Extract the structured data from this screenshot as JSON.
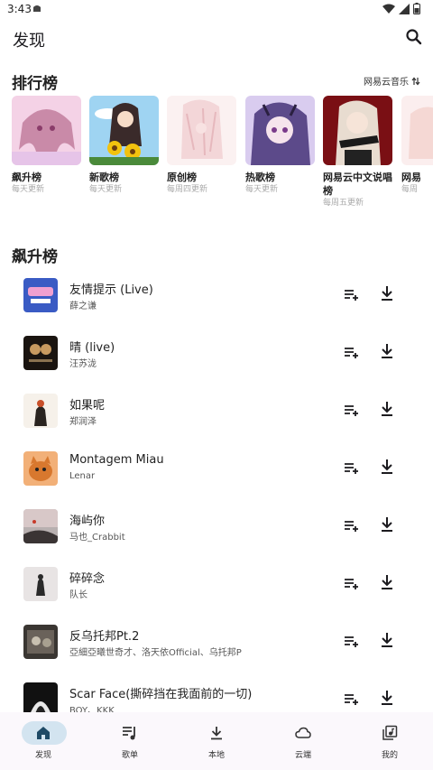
{
  "status": {
    "time": "3:43"
  },
  "appbar": {
    "title": "发现"
  },
  "charts_section": {
    "title": "排行榜",
    "source": "网易云音乐"
  },
  "ranks": [
    {
      "name": "飙升榜",
      "update": "每天更新"
    },
    {
      "name": "新歌榜",
      "update": "每天更新"
    },
    {
      "name": "原创榜",
      "update": "每周四更新"
    },
    {
      "name": "热歌榜",
      "update": "每天更新"
    },
    {
      "name": "网易云中文说唱榜",
      "update": "每周五更新"
    },
    {
      "name": "网易",
      "update": "每周"
    }
  ],
  "songs_section": {
    "title": "飙升榜"
  },
  "songs": [
    {
      "title": "友情提示 (Live)",
      "artist": "薛之谦"
    },
    {
      "title": "晴 (live)",
      "artist": "汪苏泷"
    },
    {
      "title": "如果呢",
      "artist": "郑润泽"
    },
    {
      "title": "Montagem Miau",
      "artist": "Lenar"
    },
    {
      "title": "海屿你",
      "artist": "马也_Crabbit"
    },
    {
      "title": "碎碎念",
      "artist": "队长"
    },
    {
      "title": "反乌托邦Pt.2",
      "artist": "亞細亞曦世奇才、洛天依Official、乌托邦P"
    },
    {
      "title": "Scar Face(撕碎挡在我面前的一切)",
      "artist": "BOY、KKK"
    }
  ],
  "nav": [
    {
      "label": "发现",
      "icon": "home-icon"
    },
    {
      "label": "歌单",
      "icon": "playlist-icon"
    },
    {
      "label": "本地",
      "icon": "download-icon"
    },
    {
      "label": "云端",
      "icon": "cloud-icon"
    },
    {
      "label": "我的",
      "icon": "library-icon"
    }
  ],
  "colors": {
    "nav_active_pill": "#d3e4f0",
    "nav_bg": "#fbf8fc"
  }
}
